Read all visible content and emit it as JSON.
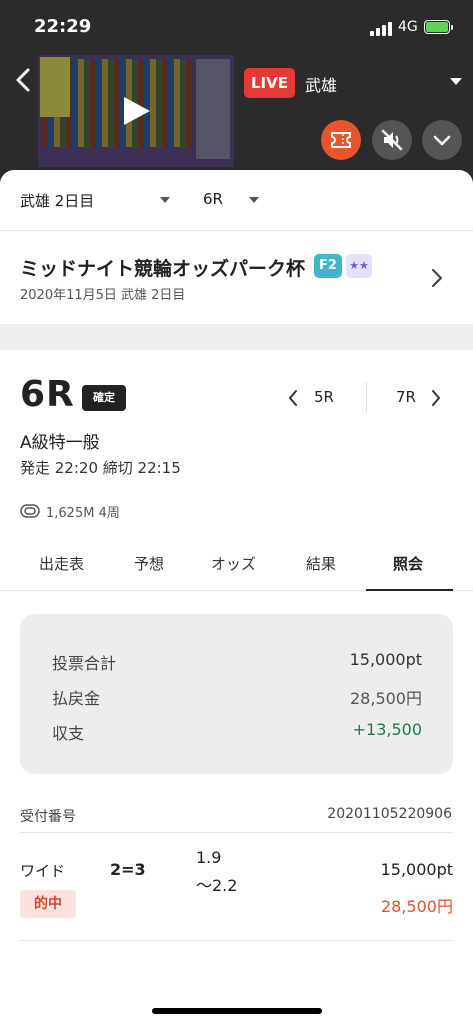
{
  "status_bar": {
    "time": "22:29",
    "network": "4G"
  },
  "player": {
    "live_label": "LIVE",
    "venue": "武雄"
  },
  "selectors": {
    "day": "武雄 2日目",
    "race": "6R"
  },
  "race_header": {
    "title": "ミッドナイト競輪オッズパーク杯",
    "grade_badge": "F2",
    "star_badge": "★★",
    "date": "2020年11月5日 武雄 2日目"
  },
  "race": {
    "number": "6R",
    "status": "確定",
    "prev": "5R",
    "next": "7R",
    "grade": "A級特一般",
    "times": "発走 22:20 締切 22:15",
    "distance": "1,625M 4周"
  },
  "tabs": [
    "出走表",
    "予想",
    "オッズ",
    "結果",
    "照会"
  ],
  "summary": {
    "rows": [
      {
        "label": "投票合計",
        "value": "15,000pt"
      },
      {
        "label": "払戻金",
        "value": "28,500円"
      },
      {
        "label": "収支",
        "value": "+13,500"
      }
    ]
  },
  "receipt": {
    "label": "受付番号",
    "number": "20201105220906"
  },
  "bet": {
    "type": "ワイド",
    "combination": "2=3",
    "odds_low": "1.9",
    "odds_high": "～2.2",
    "stake": "15,000pt",
    "result": "的中",
    "payout": "28,500円"
  },
  "colors": {
    "live": "#e53935",
    "ticket_button": "#e8552d",
    "positive": "#1f7a4a",
    "payout": "#e0512f"
  }
}
